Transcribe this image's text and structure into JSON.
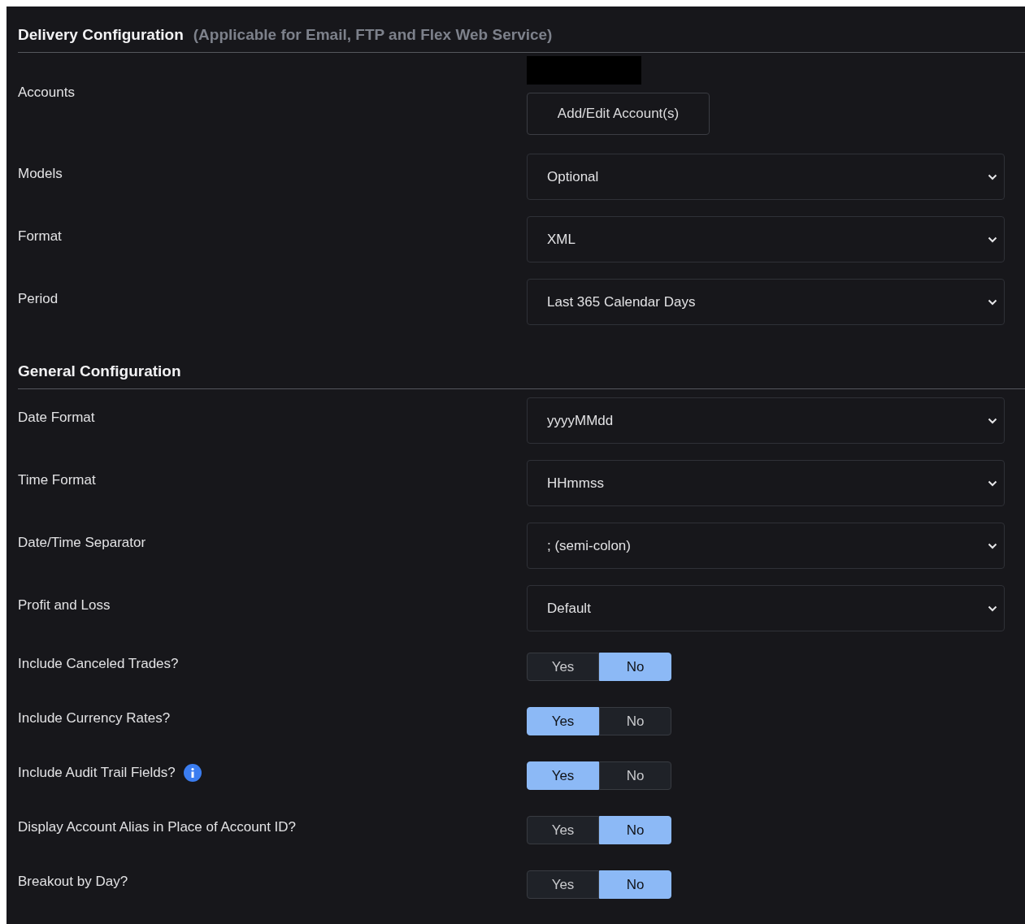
{
  "delivery": {
    "title": "Delivery Configuration",
    "subtitle": "(Applicable for Email, FTP and Flex Web Service)",
    "accounts": {
      "label": "Accounts",
      "button": "Add/Edit Account(s)"
    },
    "selects": [
      {
        "label": "Models",
        "value": "Optional"
      },
      {
        "label": "Format",
        "value": "XML"
      },
      {
        "label": "Period",
        "value": "Last 365 Calendar Days"
      }
    ]
  },
  "general": {
    "title": "General Configuration",
    "selects": [
      {
        "label": "Date Format",
        "value": "yyyyMMdd"
      },
      {
        "label": "Time Format",
        "value": "HHmmss"
      },
      {
        "label": "Date/Time Separator",
        "value": "; (semi-colon)"
      },
      {
        "label": "Profit and Loss",
        "value": "Default"
      }
    ],
    "toggles": [
      {
        "label": "Include Canceled Trades?",
        "info": false,
        "options": [
          {
            "label": "Yes",
            "selected": false
          },
          {
            "label": "No",
            "selected": true
          }
        ]
      },
      {
        "label": "Include Currency Rates?",
        "info": false,
        "options": [
          {
            "label": "Yes",
            "selected": true
          },
          {
            "label": "No",
            "selected": false
          }
        ]
      },
      {
        "label": "Include Audit Trail Fields?",
        "info": true,
        "options": [
          {
            "label": "Yes",
            "selected": true
          },
          {
            "label": "No",
            "selected": false
          }
        ]
      },
      {
        "label": "Display Account Alias in Place of Account ID?",
        "info": false,
        "options": [
          {
            "label": "Yes",
            "selected": false
          },
          {
            "label": "No",
            "selected": true
          }
        ]
      },
      {
        "label": "Breakout by Day?",
        "info": false,
        "options": [
          {
            "label": "Yes",
            "selected": false
          },
          {
            "label": "No",
            "selected": true
          }
        ]
      }
    ]
  }
}
